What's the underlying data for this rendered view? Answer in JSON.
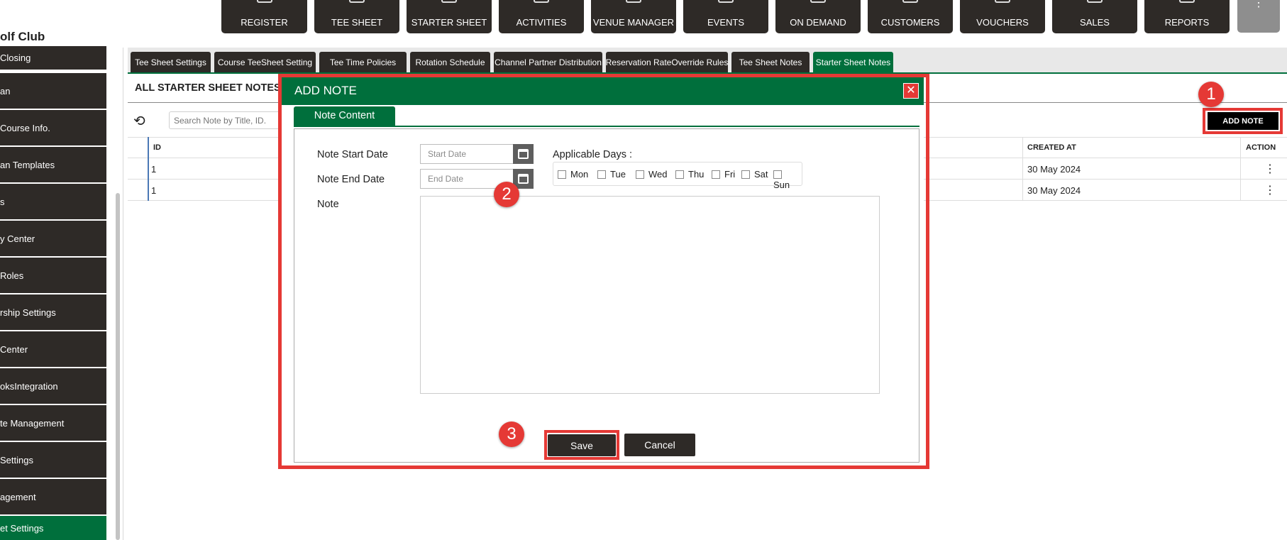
{
  "topnav": {
    "items": [
      "REGISTER",
      "TEE SHEET",
      "STARTER SHEET",
      "ACTIVITIES",
      "VENUE MANAGER",
      "EVENTS",
      "ON DEMAND",
      "CUSTOMERS",
      "VOUCHERS",
      "SALES",
      "REPORTS"
    ],
    "more": "⋮"
  },
  "club_name": "olf Club",
  "sidebar": {
    "items": [
      "Closing",
      "an",
      "Course Info.",
      "an Templates",
      "s",
      "y Center",
      "Roles",
      "rship Settings",
      "Center",
      "oksIntegration",
      "te Management",
      "Settings",
      "agement",
      "et Settings"
    ]
  },
  "tabs": [
    "Tee Sheet Settings",
    "Course TeeSheet Setting",
    "Tee Time Policies",
    "Rotation Schedule",
    "Channel Partner Distribution",
    "Reservation RateOverride Rules",
    "Tee Sheet Notes",
    "Starter Sheet Notes"
  ],
  "list": {
    "title": "ALL STARTER SHEET NOTES",
    "search_placeholder": "Search Note by Title, ID.",
    "add_note": "ADD NOTE",
    "columns": {
      "id": "ID",
      "created_at": "CREATED AT",
      "action": "ACTION"
    },
    "rows": [
      {
        "id": "1",
        "created_at": "30 May 2024",
        "action": "⋮"
      },
      {
        "id": "1",
        "created_at": "30 May 2024",
        "action": "⋮"
      }
    ]
  },
  "modal": {
    "title": "ADD NOTE",
    "close": "✕",
    "tab": "Note Content",
    "start_label": "Note Start Date",
    "start_placeholder": "Start Date",
    "end_label": "Note End Date",
    "end_placeholder": "End Date",
    "days_label": "Applicable Days :",
    "days": [
      "Mon",
      "Tue",
      "Wed",
      "Thu",
      "Fri",
      "Sat",
      "Sun"
    ],
    "note_label": "Note",
    "save": "Save",
    "cancel": "Cancel"
  },
  "annotations": [
    "1",
    "2",
    "3"
  ],
  "colors": {
    "brand_green": "#006f3c",
    "dark": "#2e2a27",
    "highlight_red": "#e53935"
  }
}
